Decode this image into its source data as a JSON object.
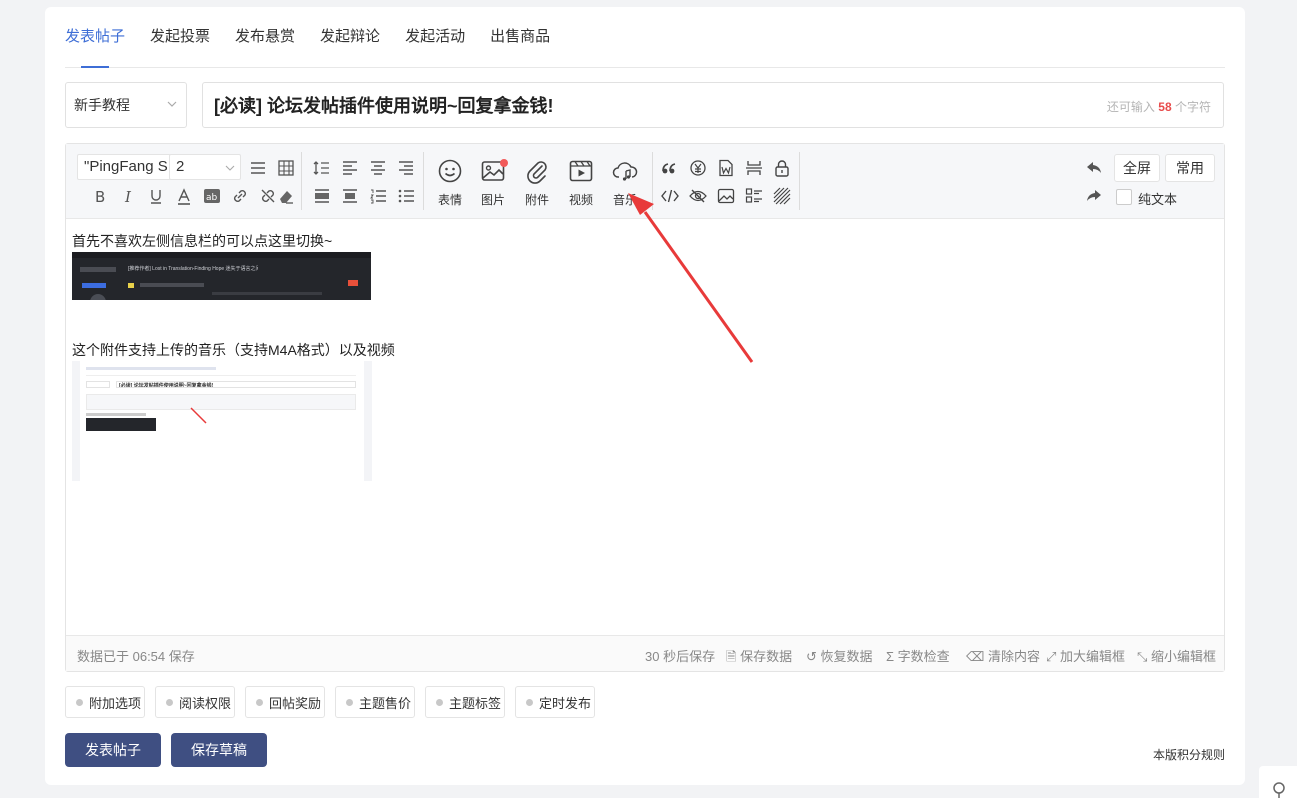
{
  "tabs": [
    "发表帖子",
    "发起投票",
    "发布悬赏",
    "发起辩论",
    "发起活动",
    "出售商品"
  ],
  "category": {
    "value": "新手教程"
  },
  "title": {
    "value": "[必读] 论坛发帖插件使用说明~回复拿金钱!",
    "remain_prefix": "还可输入",
    "remain_count": "58",
    "remain_suffix": "个字符"
  },
  "toolbar": {
    "font": "\"PingFang S",
    "size": "2",
    "emoji": "表情",
    "image": "图片",
    "attach": "附件",
    "video": "视频",
    "music": "音乐",
    "fullscreen": "全屏",
    "common": "常用",
    "plain_text": "纯文本"
  },
  "content": {
    "line1": "首先不喜欢左侧信息栏的可以点这里切换~",
    "line2": "这个附件支持上传的音乐（支持M4A格式）以及视频",
    "thumb1_title": "[推荐作者] Lost in Translation-Finding Hope 迷失于语言之间",
    "thumb2_title": "[必读] 论坛发帖插件使用说明~回复拿金钱!"
  },
  "status": {
    "saved": "数据已于 06:54 保存",
    "autosave": "30 秒后保存",
    "save_data": "保存数据",
    "restore": "恢复数据",
    "word_check": "字数检查",
    "clear": "清除内容",
    "enlarge": "加大编辑框",
    "shrink": "缩小编辑框"
  },
  "options": [
    "附加选项",
    "阅读权限",
    "回帖奖励",
    "主题售价",
    "主题标签",
    "定时发布"
  ],
  "buttons": {
    "post": "发表帖子",
    "draft": "保存草稿"
  },
  "rules_link": "本版积分规则",
  "colors": {
    "accent": "#3e6ed6",
    "primary_button": "#3f4f82",
    "counter": "#e84b4b",
    "arrow": "#e83a3a"
  }
}
